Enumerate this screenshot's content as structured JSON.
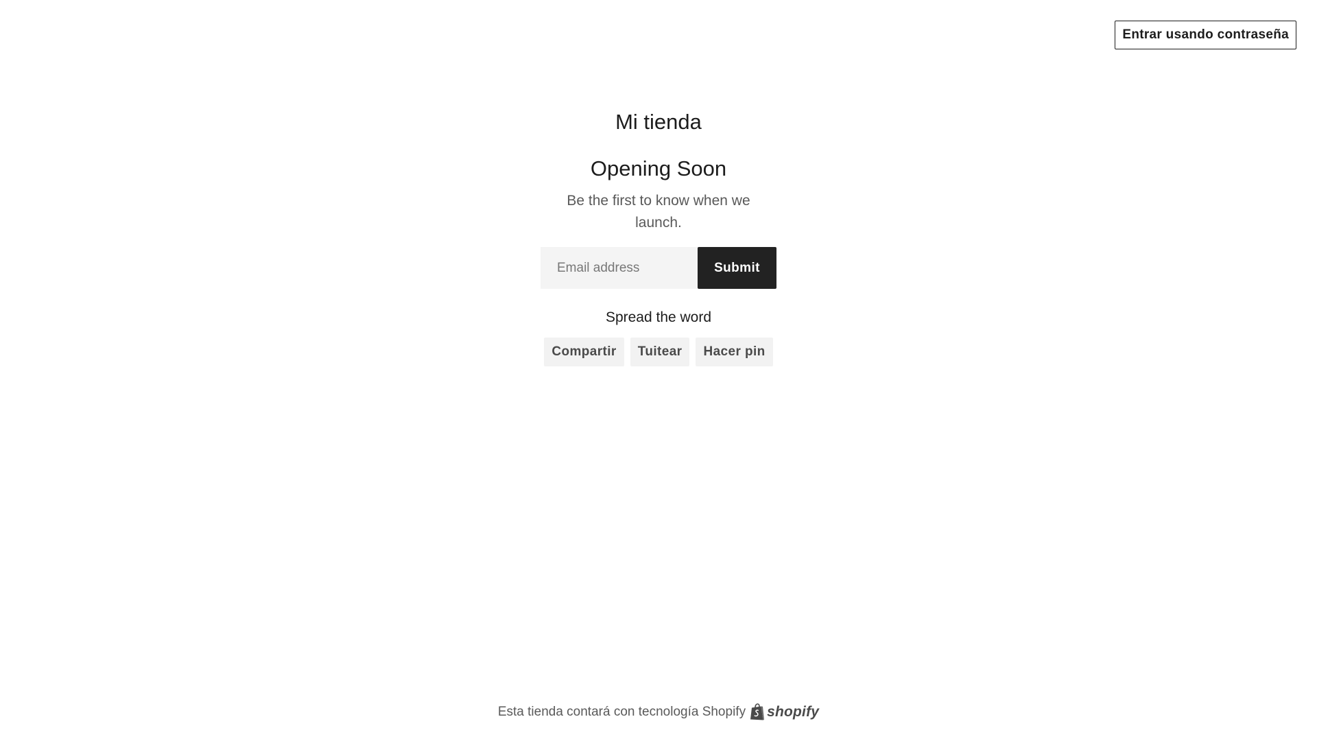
{
  "header": {
    "login_label": "Entrar usando contraseña"
  },
  "main": {
    "store_name": "Mi tienda",
    "heading": "Opening Soon",
    "subtext": "Be the first to know when we launch.",
    "email_placeholder": "Email address",
    "email_value": "",
    "submit_label": "Submit"
  },
  "share": {
    "title": "Spread the word",
    "buttons": [
      {
        "label": "Compartir"
      },
      {
        "label": "Tuitear"
      },
      {
        "label": "Hacer pin"
      }
    ]
  },
  "footer": {
    "text": "Esta tienda contará con tecnología Shopify",
    "logo_icon": "shopify-bag-icon",
    "logo_wordmark": "shopify"
  },
  "colors": {
    "text": "#1c1c1c",
    "muted_text": "#595959",
    "submit_background": "#222222",
    "input_background": "#f4f4f4",
    "share_background": "#f2f2f2"
  }
}
